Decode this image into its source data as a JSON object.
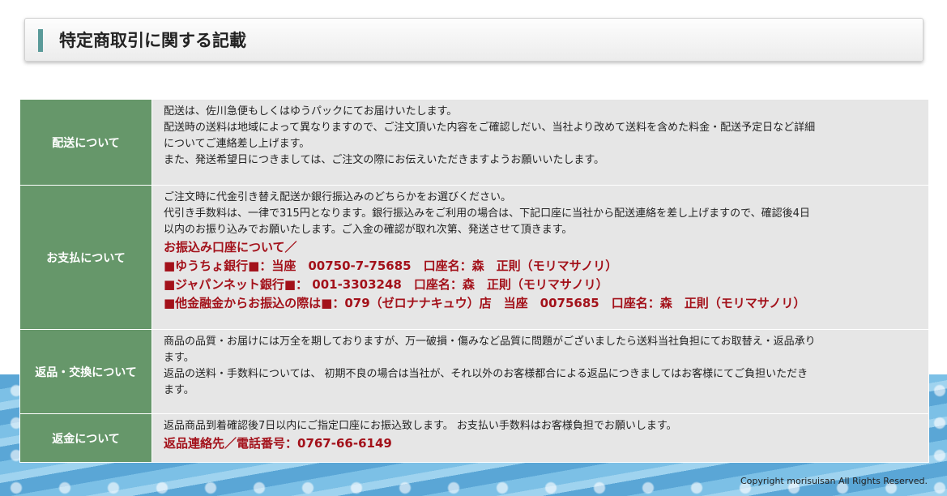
{
  "header": {
    "title": "特定商取引に関する記載"
  },
  "sections": [
    {
      "label": "配送について",
      "lines": [
        "配送は、佐川急便もしくはゆうパックにてお届けいたします。",
        "配送時の送料は地域によって異なりますので、ご注文頂いた内容をご確認しだい、当社より改めて送料を含めた料金・配送予定日など詳細",
        "についてご連絡差し上げます。",
        "また、発送希望日につきましては、ご注文の際にお伝えいただきますようお願いいたします。"
      ]
    },
    {
      "label": "お支払について",
      "lines": [
        "ご注文時に代金引き替え配送か銀行振込みのどちらかをお選びください。",
        "代引き手数料は、一律で315円となります。銀行振込みをご利用の場合は、下記口座に当社から配送連絡を差し上げますので、確認後4日",
        "以内のお振り込みでお願いたします。ご入金の確認が取れ次第、発送させて頂きます。"
      ],
      "red_lines": [
        "お振込み口座について／",
        "■ゆうちょ銀行■：当座　00750-7-75685　口座名：森　正則（モリマサノリ）",
        "■ジャパンネット銀行■： 001-3303248　口座名：森　正則（モリマサノリ）",
        "■他金融金からお振込の際は■：079（ゼロナナキュウ）店　当座　0075685　口座名：森　正則（モリマサノリ）"
      ]
    },
    {
      "label": "返品・交換について",
      "lines": [
        "商品の品質・お届けには万全を期しておりますが、万一破損・傷みなど品質に問題がございましたら送料当社負担にてお取替え・返品承り",
        "ます。",
        "返品の送料・手数料については、 初期不良の場合は当社が、それ以外のお客様都合による返品につきましてはお客様にてご負担いただき",
        "ます。"
      ]
    },
    {
      "label": "返金について",
      "lines": [
        "返品商品到着確認後7日以内にご指定口座にお振込致します。 お支払い手数料はお客様負担でお願いします。"
      ],
      "red_lines": [
        "返品連絡先／電話番号：0767-66-6149"
      ]
    }
  ],
  "footer": {
    "copyright": "Copyright morisuisan All Rights Reserved."
  },
  "colors": {
    "label_bg": "#66976a",
    "content_bg": "#e6e6e6",
    "accent_red": "#a3111a",
    "header_bar": "#5a9a99"
  }
}
